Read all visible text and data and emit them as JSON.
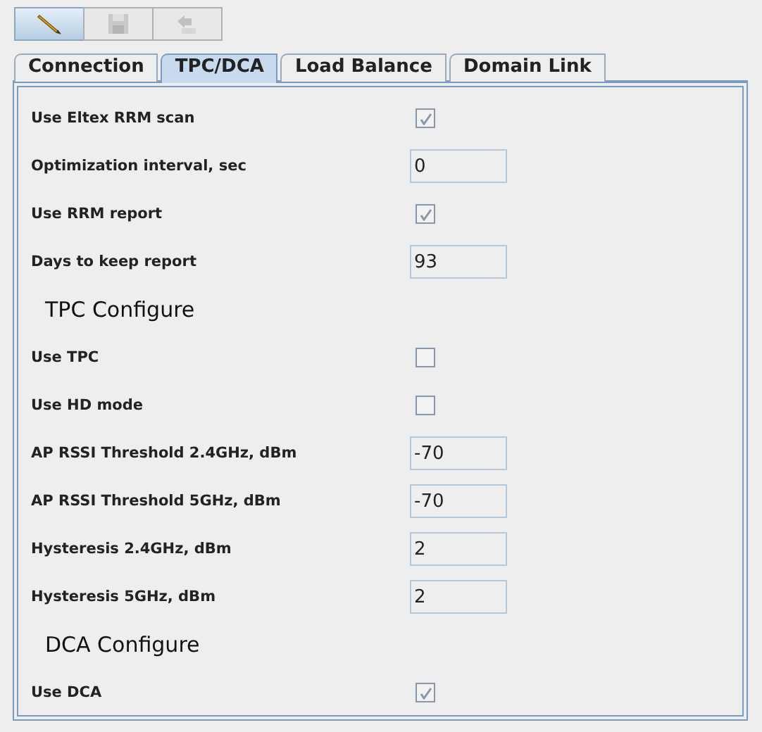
{
  "toolbar": [
    {
      "kind": "edit",
      "selected": true,
      "disabled": false
    },
    {
      "kind": "save",
      "selected": false,
      "disabled": true
    },
    {
      "kind": "config",
      "selected": false,
      "disabled": true
    }
  ],
  "tabs": [
    {
      "label": "Connection",
      "selected": false
    },
    {
      "label": "TPC/DCA",
      "selected": true
    },
    {
      "label": "Load Balance",
      "selected": false
    },
    {
      "label": "Domain Link",
      "selected": false
    }
  ],
  "rows": [
    {
      "kind": "checkbox",
      "label": "Use Eltex RRM scan",
      "checked": true
    },
    {
      "kind": "field",
      "label": "Optimization interval, sec",
      "value": "0"
    },
    {
      "kind": "checkbox",
      "label": "Use RRM report",
      "checked": true
    },
    {
      "kind": "field",
      "label": "Days to keep report",
      "value": "93"
    },
    {
      "kind": "heading",
      "label": "TPC Configure"
    },
    {
      "kind": "checkbox",
      "label": "Use TPC",
      "checked": false
    },
    {
      "kind": "checkbox",
      "label": "Use HD mode",
      "checked": false
    },
    {
      "kind": "field",
      "label": "AP RSSI Threshold 2.4GHz, dBm",
      "value": "-70"
    },
    {
      "kind": "field",
      "label": "AP RSSI Threshold 5GHz, dBm",
      "value": "-70"
    },
    {
      "kind": "field",
      "label": "Hysteresis 2.4GHz, dBm",
      "value": "2"
    },
    {
      "kind": "field",
      "label": "Hysteresis 5GHz, dBm",
      "value": "2"
    },
    {
      "kind": "heading",
      "label": "DCA Configure"
    },
    {
      "kind": "checkbox",
      "label": "Use DCA",
      "checked": true
    }
  ]
}
